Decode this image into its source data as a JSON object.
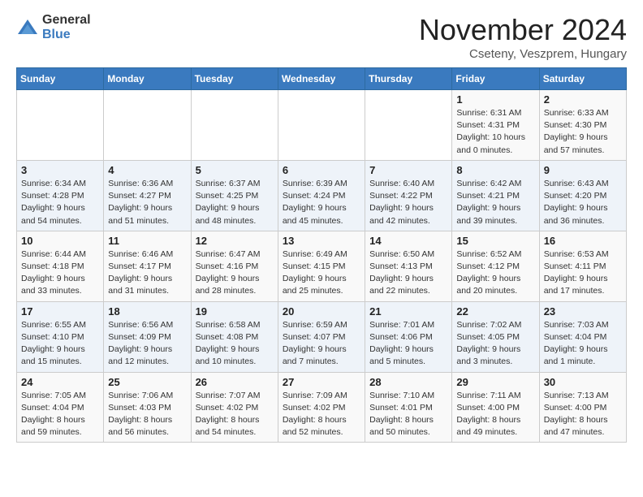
{
  "header": {
    "logo_general": "General",
    "logo_blue": "Blue",
    "month_title": "November 2024",
    "location": "Cseteny, Veszprem, Hungary"
  },
  "weekdays": [
    "Sunday",
    "Monday",
    "Tuesday",
    "Wednesday",
    "Thursday",
    "Friday",
    "Saturday"
  ],
  "weeks": [
    [
      {
        "day": "",
        "info": ""
      },
      {
        "day": "",
        "info": ""
      },
      {
        "day": "",
        "info": ""
      },
      {
        "day": "",
        "info": ""
      },
      {
        "day": "",
        "info": ""
      },
      {
        "day": "1",
        "info": "Sunrise: 6:31 AM\nSunset: 4:31 PM\nDaylight: 10 hours\nand 0 minutes."
      },
      {
        "day": "2",
        "info": "Sunrise: 6:33 AM\nSunset: 4:30 PM\nDaylight: 9 hours\nand 57 minutes."
      }
    ],
    [
      {
        "day": "3",
        "info": "Sunrise: 6:34 AM\nSunset: 4:28 PM\nDaylight: 9 hours\nand 54 minutes."
      },
      {
        "day": "4",
        "info": "Sunrise: 6:36 AM\nSunset: 4:27 PM\nDaylight: 9 hours\nand 51 minutes."
      },
      {
        "day": "5",
        "info": "Sunrise: 6:37 AM\nSunset: 4:25 PM\nDaylight: 9 hours\nand 48 minutes."
      },
      {
        "day": "6",
        "info": "Sunrise: 6:39 AM\nSunset: 4:24 PM\nDaylight: 9 hours\nand 45 minutes."
      },
      {
        "day": "7",
        "info": "Sunrise: 6:40 AM\nSunset: 4:22 PM\nDaylight: 9 hours\nand 42 minutes."
      },
      {
        "day": "8",
        "info": "Sunrise: 6:42 AM\nSunset: 4:21 PM\nDaylight: 9 hours\nand 39 minutes."
      },
      {
        "day": "9",
        "info": "Sunrise: 6:43 AM\nSunset: 4:20 PM\nDaylight: 9 hours\nand 36 minutes."
      }
    ],
    [
      {
        "day": "10",
        "info": "Sunrise: 6:44 AM\nSunset: 4:18 PM\nDaylight: 9 hours\nand 33 minutes."
      },
      {
        "day": "11",
        "info": "Sunrise: 6:46 AM\nSunset: 4:17 PM\nDaylight: 9 hours\nand 31 minutes."
      },
      {
        "day": "12",
        "info": "Sunrise: 6:47 AM\nSunset: 4:16 PM\nDaylight: 9 hours\nand 28 minutes."
      },
      {
        "day": "13",
        "info": "Sunrise: 6:49 AM\nSunset: 4:15 PM\nDaylight: 9 hours\nand 25 minutes."
      },
      {
        "day": "14",
        "info": "Sunrise: 6:50 AM\nSunset: 4:13 PM\nDaylight: 9 hours\nand 22 minutes."
      },
      {
        "day": "15",
        "info": "Sunrise: 6:52 AM\nSunset: 4:12 PM\nDaylight: 9 hours\nand 20 minutes."
      },
      {
        "day": "16",
        "info": "Sunrise: 6:53 AM\nSunset: 4:11 PM\nDaylight: 9 hours\nand 17 minutes."
      }
    ],
    [
      {
        "day": "17",
        "info": "Sunrise: 6:55 AM\nSunset: 4:10 PM\nDaylight: 9 hours\nand 15 minutes."
      },
      {
        "day": "18",
        "info": "Sunrise: 6:56 AM\nSunset: 4:09 PM\nDaylight: 9 hours\nand 12 minutes."
      },
      {
        "day": "19",
        "info": "Sunrise: 6:58 AM\nSunset: 4:08 PM\nDaylight: 9 hours\nand 10 minutes."
      },
      {
        "day": "20",
        "info": "Sunrise: 6:59 AM\nSunset: 4:07 PM\nDaylight: 9 hours\nand 7 minutes."
      },
      {
        "day": "21",
        "info": "Sunrise: 7:01 AM\nSunset: 4:06 PM\nDaylight: 9 hours\nand 5 minutes."
      },
      {
        "day": "22",
        "info": "Sunrise: 7:02 AM\nSunset: 4:05 PM\nDaylight: 9 hours\nand 3 minutes."
      },
      {
        "day": "23",
        "info": "Sunrise: 7:03 AM\nSunset: 4:04 PM\nDaylight: 9 hours\nand 1 minute."
      }
    ],
    [
      {
        "day": "24",
        "info": "Sunrise: 7:05 AM\nSunset: 4:04 PM\nDaylight: 8 hours\nand 59 minutes."
      },
      {
        "day": "25",
        "info": "Sunrise: 7:06 AM\nSunset: 4:03 PM\nDaylight: 8 hours\nand 56 minutes."
      },
      {
        "day": "26",
        "info": "Sunrise: 7:07 AM\nSunset: 4:02 PM\nDaylight: 8 hours\nand 54 minutes."
      },
      {
        "day": "27",
        "info": "Sunrise: 7:09 AM\nSunset: 4:02 PM\nDaylight: 8 hours\nand 52 minutes."
      },
      {
        "day": "28",
        "info": "Sunrise: 7:10 AM\nSunset: 4:01 PM\nDaylight: 8 hours\nand 50 minutes."
      },
      {
        "day": "29",
        "info": "Sunrise: 7:11 AM\nSunset: 4:00 PM\nDaylight: 8 hours\nand 49 minutes."
      },
      {
        "day": "30",
        "info": "Sunrise: 7:13 AM\nSunset: 4:00 PM\nDaylight: 8 hours\nand 47 minutes."
      }
    ]
  ]
}
